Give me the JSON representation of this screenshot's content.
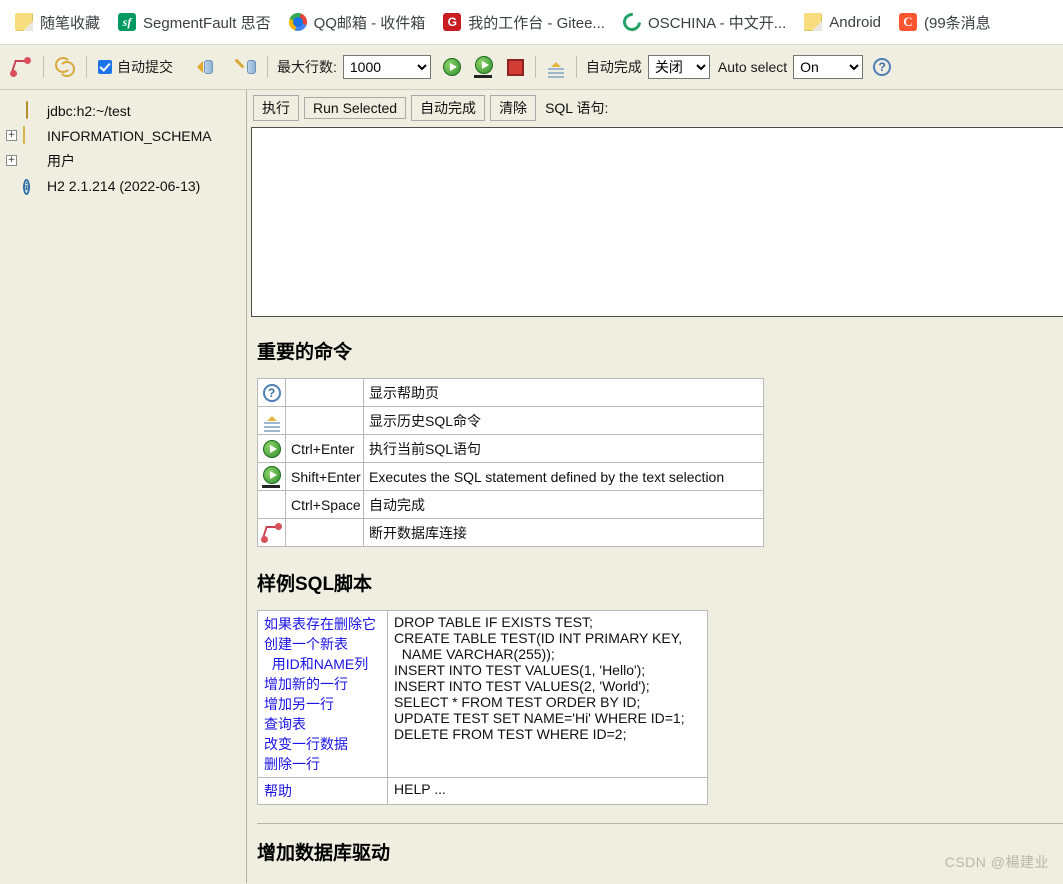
{
  "browser": {
    "bookmarks": [
      {
        "label": "随笔收藏",
        "icon": "folder-icon"
      },
      {
        "label": "SegmentFault 思否",
        "icon": "segmentfault-icon",
        "glyph": "sf"
      },
      {
        "label": "QQ邮箱 - 收件箱",
        "icon": "qqmail-icon"
      },
      {
        "label": "我的工作台 - Gitee...",
        "icon": "gitee-icon",
        "glyph": "G"
      },
      {
        "label": "OSCHINA - 中文开...",
        "icon": "oschina-icon"
      },
      {
        "label": "Android",
        "icon": "folder-icon"
      },
      {
        "label": "(99条消息",
        "icon": "csdn-icon",
        "glyph": "C"
      }
    ]
  },
  "toolbar": {
    "disconnect_icon": "disconnect-icon",
    "refresh_icon": "refresh-icon",
    "autocommit_label": "自动提交",
    "autocommit_checked": true,
    "rollback_icon": "rollback-icon",
    "commit_icon": "commit-icon",
    "maxrows_label": "最大行数:",
    "maxrows_value": "1000",
    "maxrows_options": [
      "1000"
    ],
    "run_icon": "run-icon",
    "run_selected_icon": "run-selected-icon",
    "stop_icon": "stop-icon",
    "history_icon": "history-icon",
    "autocomplete_label": "自动完成",
    "autocomplete_value": "关闭",
    "autocomplete_options": [
      "关闭"
    ],
    "autoselect_label": "Auto select",
    "autoselect_value": "On",
    "autoselect_options": [
      "On"
    ],
    "help_icon": "help-icon"
  },
  "sidebar": {
    "items": [
      {
        "label": "jdbc:h2:~/test",
        "icon": "database-icon",
        "expander": ""
      },
      {
        "label": "INFORMATION_SCHEMA",
        "icon": "folder-icon",
        "expander": "+"
      },
      {
        "label": "用户",
        "icon": "users-icon",
        "expander": "+"
      },
      {
        "label": "H2 2.1.214 (2022-06-13)",
        "icon": "info-icon",
        "expander": ""
      }
    ]
  },
  "editor": {
    "buttons": [
      "执行",
      "Run Selected",
      "自动完成",
      "清除"
    ],
    "sql_label": "SQL 语句:",
    "sql_value": ""
  },
  "commands": {
    "title": "重要的命令",
    "rows": [
      {
        "icon": "help-icon",
        "key": "",
        "desc": "显示帮助页"
      },
      {
        "icon": "history-icon",
        "key": "",
        "desc": "显示历史SQL命令"
      },
      {
        "icon": "run-icon",
        "key": "Ctrl+Enter",
        "desc": "执行当前SQL语句"
      },
      {
        "icon": "run-selected-icon",
        "key": "Shift+Enter",
        "desc": "Executes the SQL statement defined by the text selection"
      },
      {
        "icon": "",
        "key": "Ctrl+Space",
        "desc": "自动完成"
      },
      {
        "icon": "disconnect-icon",
        "key": "",
        "desc": "断开数据库连接"
      }
    ]
  },
  "sample": {
    "title": "样例SQL脚本",
    "rows": [
      {
        "zh": "如果表存在删除它\n创建一个新表\n  用ID和NAME列\n增加新的一行\n增加另一行\n查询表\n改变一行数据\n删除一行",
        "sql": "DROP TABLE IF EXISTS TEST;\nCREATE TABLE TEST(ID INT PRIMARY KEY,\n  NAME VARCHAR(255));\nINSERT INTO TEST VALUES(1, 'Hello');\nINSERT INTO TEST VALUES(2, 'World');\nSELECT * FROM TEST ORDER BY ID;\nUPDATE TEST SET NAME='Hi' WHERE ID=1;\nDELETE FROM TEST WHERE ID=2;"
      },
      {
        "zh": "帮助",
        "sql": "HELP ..."
      }
    ]
  },
  "drivers": {
    "title": "增加数据库驱动"
  },
  "watermark": {
    "text": "CSDN @楊建业"
  }
}
